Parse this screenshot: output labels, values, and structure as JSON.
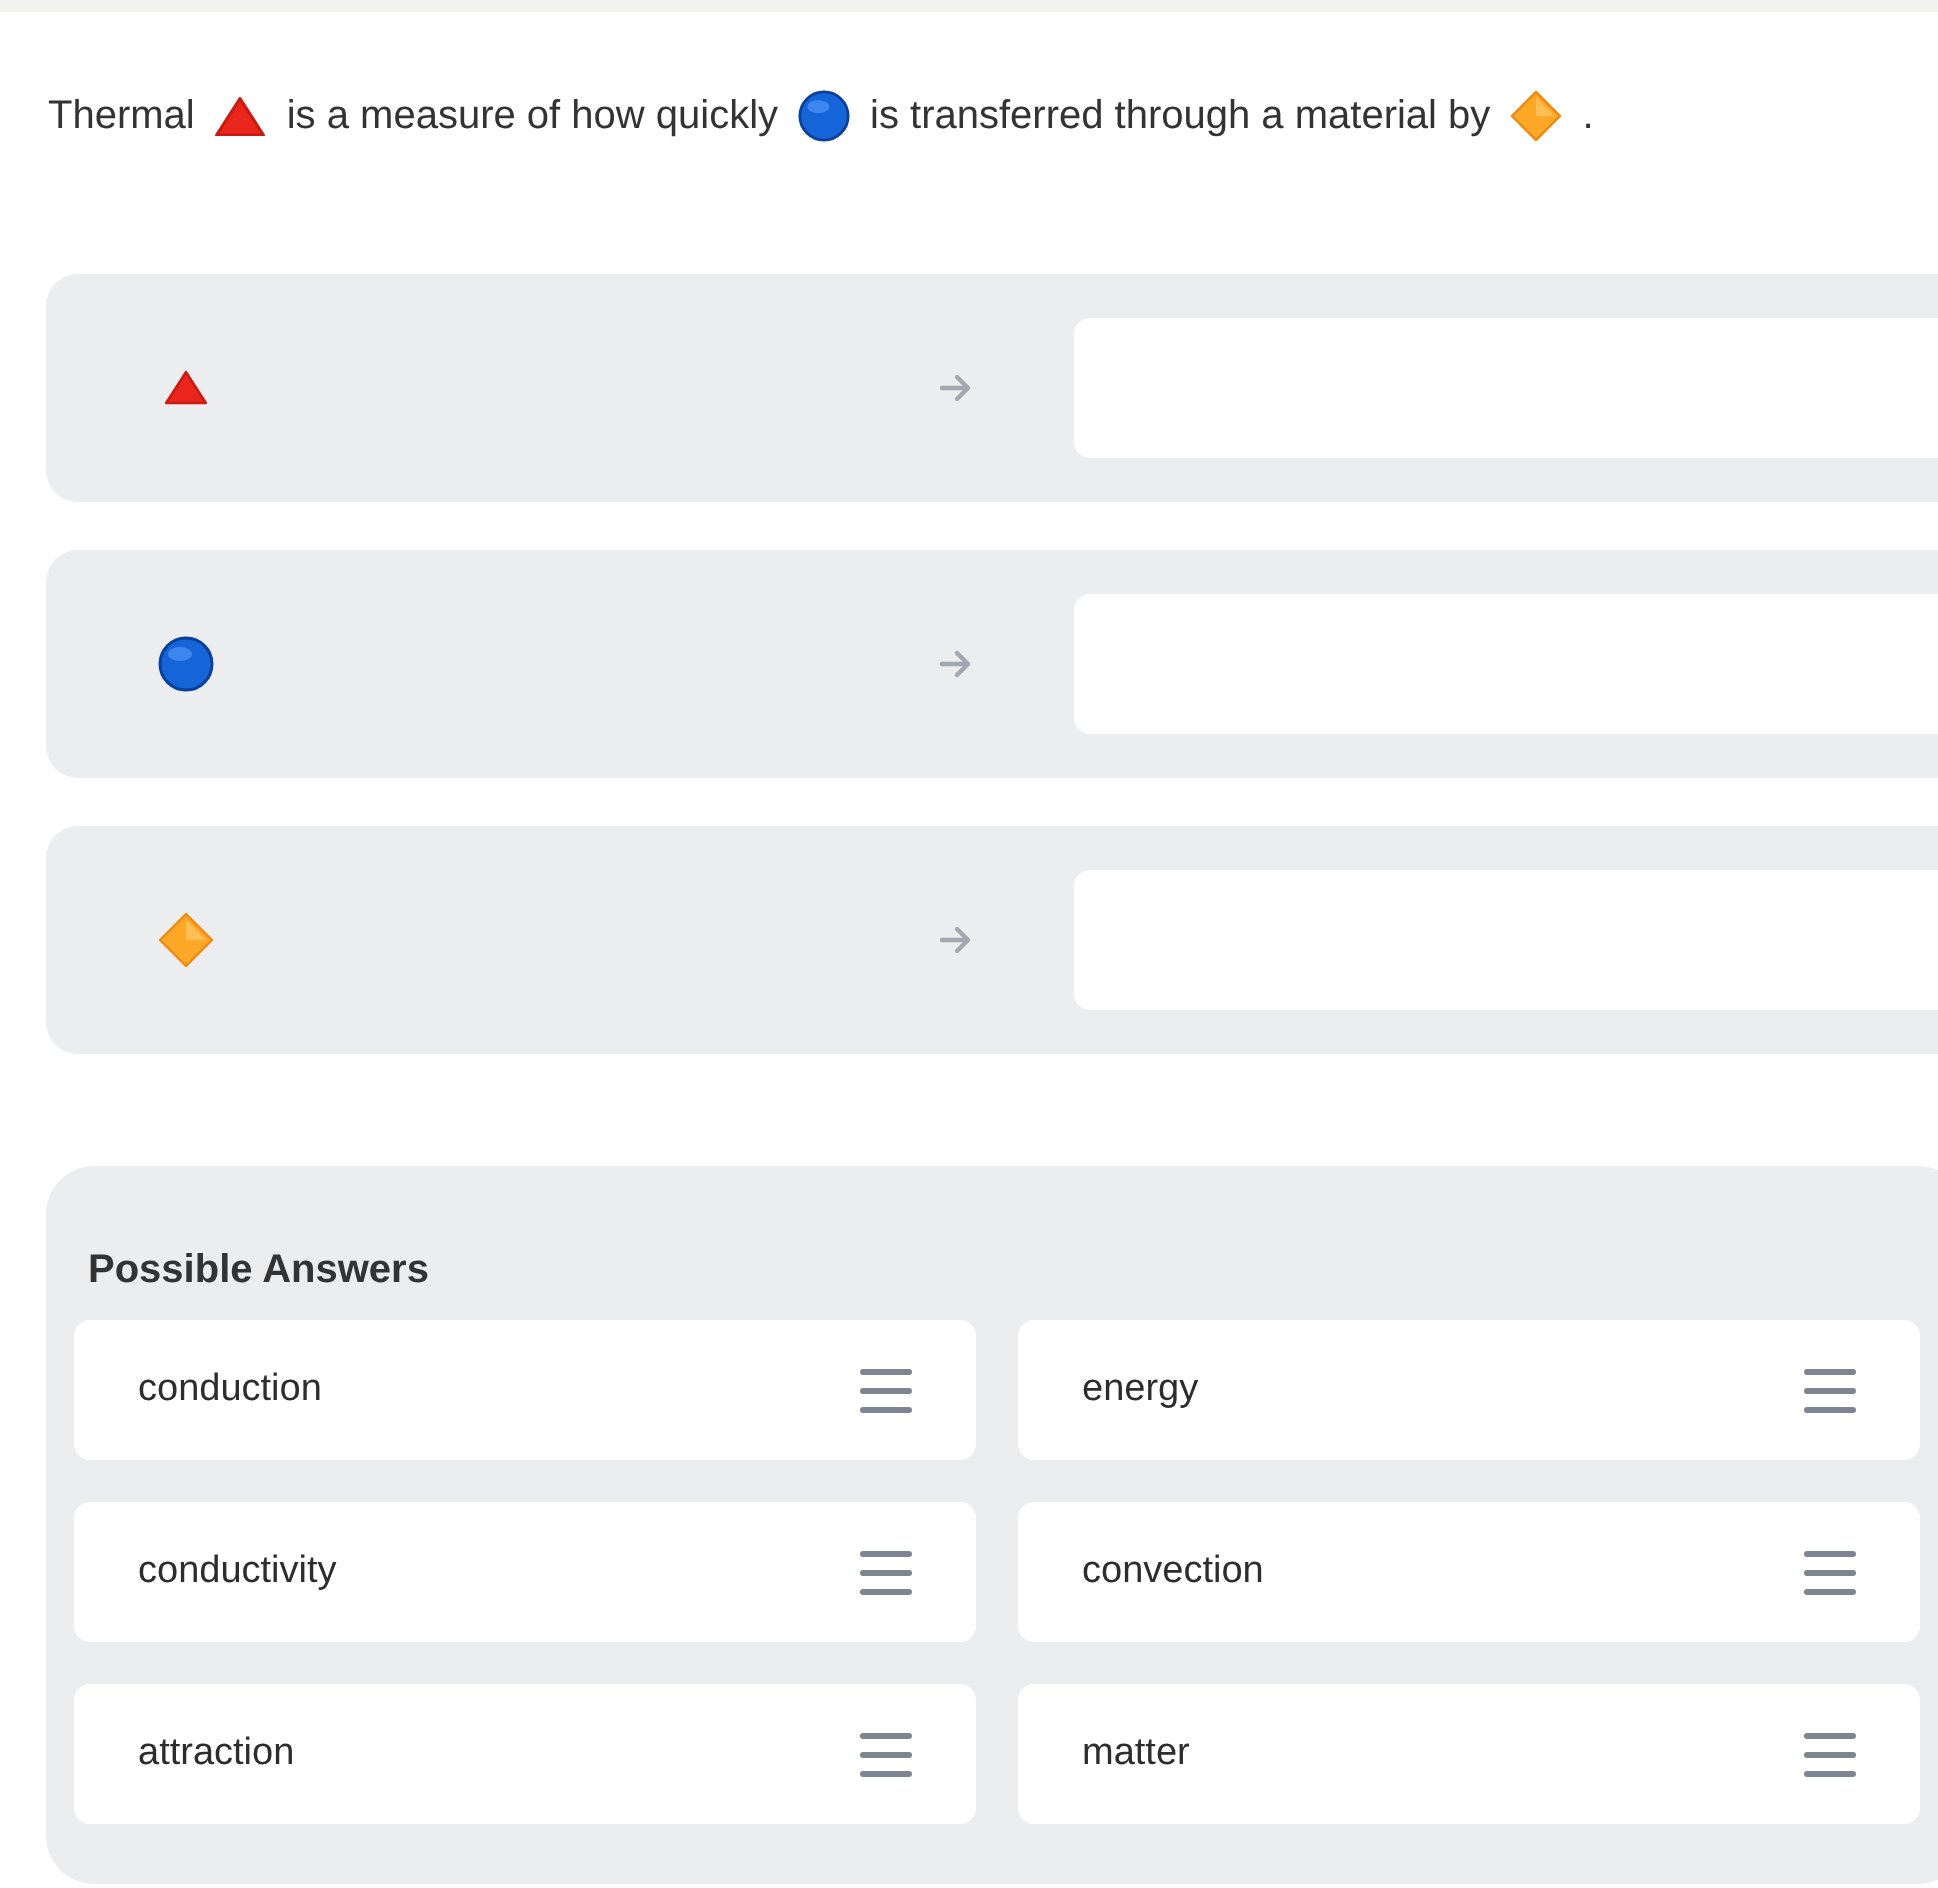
{
  "prompt": [
    {
      "kind": "text",
      "text": "Thermal"
    },
    {
      "kind": "triangle"
    },
    {
      "kind": "text",
      "text": "is a measure of how quickly"
    },
    {
      "kind": "circle"
    },
    {
      "kind": "text",
      "text": "is transferred through a material by"
    },
    {
      "kind": "diamond"
    },
    {
      "kind": "text",
      "text": "."
    }
  ],
  "targets": [
    {
      "kind": "triangle"
    },
    {
      "kind": "circle"
    },
    {
      "kind": "diamond"
    }
  ],
  "possible_answers": {
    "title": "Possible Answers",
    "items": [
      {
        "label": "conduction"
      },
      {
        "label": "energy"
      },
      {
        "label": "conductivity"
      },
      {
        "label": "convection"
      },
      {
        "label": "attraction"
      },
      {
        "label": "matter"
      }
    ]
  }
}
